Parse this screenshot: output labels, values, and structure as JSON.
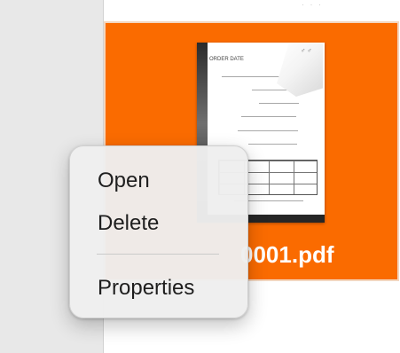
{
  "file": {
    "name": "0001.pdf",
    "thumbnail_title": "ORDER DATE",
    "corner_logo": "♂ ♂",
    "tile_color": "#fa6b00"
  },
  "context_menu": {
    "items": [
      {
        "label": "Open"
      },
      {
        "label": "Delete"
      },
      {
        "label": "Properties"
      }
    ]
  },
  "background_text": "· · ·",
  "colors": {
    "sidebar": "#e8e8e8",
    "menu_background": "#eeeeee",
    "menu_text": "#1e1e1e",
    "file_label": "#ffffff"
  },
  "icons": {
    "pdf_document": "pdf-file-thumbnail",
    "page_curl": "page-curl-icon"
  }
}
